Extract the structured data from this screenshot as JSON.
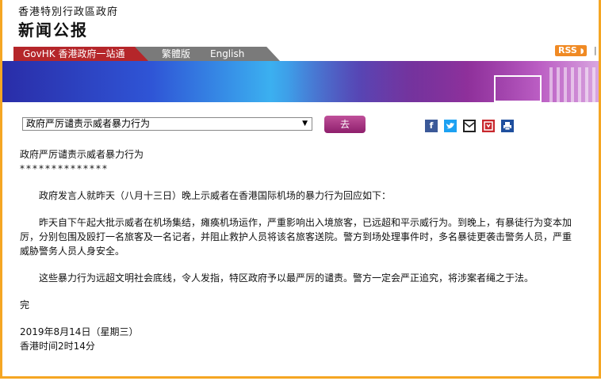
{
  "header": {
    "org": "香港特別行政區政府",
    "title": "新闻公报"
  },
  "nav": {
    "govhk": "GovHK 香港政府一站通",
    "traditional": "繁體版",
    "english": "English",
    "rss": "RSS"
  },
  "toolbar": {
    "selected_article": "政府严厉谴责示威者暴力行为",
    "go_label": "去"
  },
  "share_icons": [
    "facebook-icon",
    "twitter-icon",
    "email-icon",
    "bookmark-icon",
    "print-icon"
  ],
  "article": {
    "title": "政府严厉谴责示威者暴力行为",
    "separator": "**************",
    "para1": "　　政府发言人就昨天（八月十三日）晚上示威者在香港国际机场的暴力行为回应如下：",
    "para2": "　　昨天自下午起大批示威者在机场集结，瘫痪机场运作，严重影响出入境旅客，已远超和平示威行为。到晚上，有暴徒行为变本加厉，分别包围及殴打一名旅客及一名记者，并阻止救护人员将该名旅客送院。警方到场处理事件时，多名暴徒更袭击警务人员，严重威胁警务人员人身安全。",
    "para3": "　　这些暴力行为远超文明社会底线，令人发指，特区政府予以最严厉的谴责。警方一定会严正追究，将涉案者绳之于法。",
    "end": "完",
    "date": "2019年8月14日（星期三）",
    "time": "香港时间2时14分"
  },
  "colors": {
    "accent_orange": "#f5a623",
    "govhk_red": "#b5262a",
    "button_purple": "#a0307a"
  }
}
